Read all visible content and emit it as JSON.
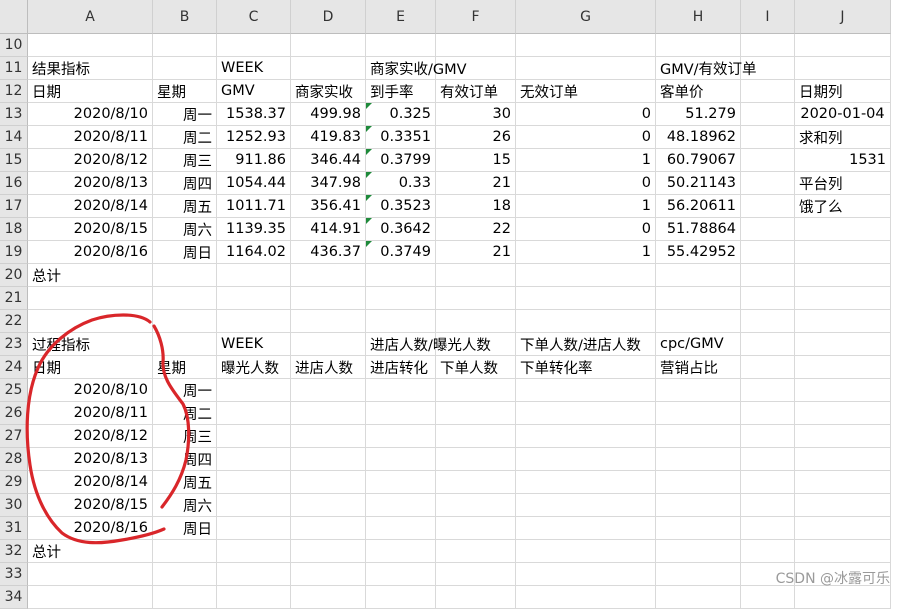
{
  "columns": [
    "A",
    "B",
    "C",
    "D",
    "E",
    "F",
    "G",
    "H",
    "I",
    "J"
  ],
  "rows": [
    10,
    11,
    12,
    13,
    14,
    15,
    16,
    17,
    18,
    19,
    20,
    21,
    22,
    23,
    24,
    25,
    26,
    27,
    28,
    29,
    30,
    31,
    32,
    33,
    34
  ],
  "cells": [
    {
      "r": 11,
      "c": "A",
      "v": "结果指标"
    },
    {
      "r": 11,
      "c": "C",
      "v": "WEEK"
    },
    {
      "r": 11,
      "c": "E",
      "v": "商家实收/GMV"
    },
    {
      "r": 11,
      "c": "H",
      "v": "GMV/有效订单"
    },
    {
      "r": 12,
      "c": "A",
      "v": "日期"
    },
    {
      "r": 12,
      "c": "B",
      "v": "星期"
    },
    {
      "r": 12,
      "c": "C",
      "v": "GMV"
    },
    {
      "r": 12,
      "c": "D",
      "v": "商家实收"
    },
    {
      "r": 12,
      "c": "E",
      "v": "到手率"
    },
    {
      "r": 12,
      "c": "F",
      "v": "有效订单"
    },
    {
      "r": 12,
      "c": "G",
      "v": "无效订单"
    },
    {
      "r": 12,
      "c": "H",
      "v": "客单价"
    },
    {
      "r": 12,
      "c": "J",
      "v": "日期列"
    },
    {
      "r": 13,
      "c": "A",
      "v": "2020/8/10",
      "a": "num"
    },
    {
      "r": 13,
      "c": "B",
      "v": "周一",
      "a": "num"
    },
    {
      "r": 13,
      "c": "C",
      "v": "1538.37",
      "a": "num"
    },
    {
      "r": 13,
      "c": "D",
      "v": "499.98",
      "a": "num"
    },
    {
      "r": 13,
      "c": "E",
      "v": "0.325",
      "a": "num",
      "tri": true
    },
    {
      "r": 13,
      "c": "F",
      "v": "30",
      "a": "num"
    },
    {
      "r": 13,
      "c": "G",
      "v": "0",
      "a": "num"
    },
    {
      "r": 13,
      "c": "H",
      "v": "51.279",
      "a": "num"
    },
    {
      "r": 13,
      "c": "J",
      "v": "2020-01-04",
      "a": "ctr"
    },
    {
      "r": 14,
      "c": "A",
      "v": "2020/8/11",
      "a": "num"
    },
    {
      "r": 14,
      "c": "B",
      "v": "周二",
      "a": "num"
    },
    {
      "r": 14,
      "c": "C",
      "v": "1252.93",
      "a": "num"
    },
    {
      "r": 14,
      "c": "D",
      "v": "419.83",
      "a": "num"
    },
    {
      "r": 14,
      "c": "E",
      "v": "0.3351",
      "a": "num",
      "tri": true
    },
    {
      "r": 14,
      "c": "F",
      "v": "26",
      "a": "num"
    },
    {
      "r": 14,
      "c": "G",
      "v": "0",
      "a": "num"
    },
    {
      "r": 14,
      "c": "H",
      "v": "48.18962",
      "a": "num"
    },
    {
      "r": 14,
      "c": "J",
      "v": "求和列"
    },
    {
      "r": 15,
      "c": "A",
      "v": "2020/8/12",
      "a": "num"
    },
    {
      "r": 15,
      "c": "B",
      "v": "周三",
      "a": "num"
    },
    {
      "r": 15,
      "c": "C",
      "v": "911.86",
      "a": "num"
    },
    {
      "r": 15,
      "c": "D",
      "v": "346.44",
      "a": "num"
    },
    {
      "r": 15,
      "c": "E",
      "v": "0.3799",
      "a": "num",
      "tri": true
    },
    {
      "r": 15,
      "c": "F",
      "v": "15",
      "a": "num"
    },
    {
      "r": 15,
      "c": "G",
      "v": "1",
      "a": "num"
    },
    {
      "r": 15,
      "c": "H",
      "v": "60.79067",
      "a": "num"
    },
    {
      "r": 15,
      "c": "J",
      "v": "1531",
      "a": "num"
    },
    {
      "r": 16,
      "c": "A",
      "v": "2020/8/13",
      "a": "num"
    },
    {
      "r": 16,
      "c": "B",
      "v": "周四",
      "a": "num"
    },
    {
      "r": 16,
      "c": "C",
      "v": "1054.44",
      "a": "num"
    },
    {
      "r": 16,
      "c": "D",
      "v": "347.98",
      "a": "num"
    },
    {
      "r": 16,
      "c": "E",
      "v": "0.33",
      "a": "num",
      "tri": true
    },
    {
      "r": 16,
      "c": "F",
      "v": "21",
      "a": "num"
    },
    {
      "r": 16,
      "c": "G",
      "v": "0",
      "a": "num"
    },
    {
      "r": 16,
      "c": "H",
      "v": "50.21143",
      "a": "num"
    },
    {
      "r": 16,
      "c": "J",
      "v": "平台列"
    },
    {
      "r": 17,
      "c": "A",
      "v": "2020/8/14",
      "a": "num"
    },
    {
      "r": 17,
      "c": "B",
      "v": "周五",
      "a": "num"
    },
    {
      "r": 17,
      "c": "C",
      "v": "1011.71",
      "a": "num"
    },
    {
      "r": 17,
      "c": "D",
      "v": "356.41",
      "a": "num"
    },
    {
      "r": 17,
      "c": "E",
      "v": "0.3523",
      "a": "num",
      "tri": true
    },
    {
      "r": 17,
      "c": "F",
      "v": "18",
      "a": "num"
    },
    {
      "r": 17,
      "c": "G",
      "v": "1",
      "a": "num"
    },
    {
      "r": 17,
      "c": "H",
      "v": "56.20611",
      "a": "num"
    },
    {
      "r": 17,
      "c": "J",
      "v": "饿了么"
    },
    {
      "r": 18,
      "c": "A",
      "v": "2020/8/15",
      "a": "num"
    },
    {
      "r": 18,
      "c": "B",
      "v": "周六",
      "a": "num"
    },
    {
      "r": 18,
      "c": "C",
      "v": "1139.35",
      "a": "num"
    },
    {
      "r": 18,
      "c": "D",
      "v": "414.91",
      "a": "num"
    },
    {
      "r": 18,
      "c": "E",
      "v": "0.3642",
      "a": "num",
      "tri": true
    },
    {
      "r": 18,
      "c": "F",
      "v": "22",
      "a": "num"
    },
    {
      "r": 18,
      "c": "G",
      "v": "0",
      "a": "num"
    },
    {
      "r": 18,
      "c": "H",
      "v": "51.78864",
      "a": "num"
    },
    {
      "r": 19,
      "c": "A",
      "v": "2020/8/16",
      "a": "num"
    },
    {
      "r": 19,
      "c": "B",
      "v": "周日",
      "a": "num"
    },
    {
      "r": 19,
      "c": "C",
      "v": "1164.02",
      "a": "num"
    },
    {
      "r": 19,
      "c": "D",
      "v": "436.37",
      "a": "num"
    },
    {
      "r": 19,
      "c": "E",
      "v": "0.3749",
      "a": "num",
      "tri": true
    },
    {
      "r": 19,
      "c": "F",
      "v": "21",
      "a": "num"
    },
    {
      "r": 19,
      "c": "G",
      "v": "1",
      "a": "num"
    },
    {
      "r": 19,
      "c": "H",
      "v": "55.42952",
      "a": "num"
    },
    {
      "r": 20,
      "c": "A",
      "v": "总计"
    },
    {
      "r": 23,
      "c": "A",
      "v": "过程指标"
    },
    {
      "r": 23,
      "c": "C",
      "v": "WEEK"
    },
    {
      "r": 23,
      "c": "E",
      "v": "进店人数/曝光人数"
    },
    {
      "r": 23,
      "c": "G",
      "v": "下单人数/进店人数"
    },
    {
      "r": 23,
      "c": "H",
      "v": "cpc/GMV"
    },
    {
      "r": 24,
      "c": "A",
      "v": "日期"
    },
    {
      "r": 24,
      "c": "B",
      "v": "星期"
    },
    {
      "r": 24,
      "c": "C",
      "v": "曝光人数"
    },
    {
      "r": 24,
      "c": "D",
      "v": "进店人数"
    },
    {
      "r": 24,
      "c": "E",
      "v": "进店转化"
    },
    {
      "r": 24,
      "c": "F",
      "v": "下单人数"
    },
    {
      "r": 24,
      "c": "G",
      "v": "下单转化率"
    },
    {
      "r": 24,
      "c": "H",
      "v": "营销占比"
    },
    {
      "r": 25,
      "c": "A",
      "v": "2020/8/10",
      "a": "num"
    },
    {
      "r": 25,
      "c": "B",
      "v": "周一",
      "a": "num"
    },
    {
      "r": 26,
      "c": "A",
      "v": "2020/8/11",
      "a": "num"
    },
    {
      "r": 26,
      "c": "B",
      "v": "周二",
      "a": "num"
    },
    {
      "r": 27,
      "c": "A",
      "v": "2020/8/12",
      "a": "num"
    },
    {
      "r": 27,
      "c": "B",
      "v": "周三",
      "a": "num"
    },
    {
      "r": 28,
      "c": "A",
      "v": "2020/8/13",
      "a": "num"
    },
    {
      "r": 28,
      "c": "B",
      "v": "周四",
      "a": "num"
    },
    {
      "r": 29,
      "c": "A",
      "v": "2020/8/14",
      "a": "num"
    },
    {
      "r": 29,
      "c": "B",
      "v": "周五",
      "a": "num"
    },
    {
      "r": 30,
      "c": "A",
      "v": "2020/8/15",
      "a": "num"
    },
    {
      "r": 30,
      "c": "B",
      "v": "周六",
      "a": "num"
    },
    {
      "r": 31,
      "c": "A",
      "v": "2020/8/16",
      "a": "num"
    },
    {
      "r": 31,
      "c": "B",
      "v": "周日",
      "a": "num"
    },
    {
      "r": 32,
      "c": "A",
      "v": "总计"
    }
  ],
  "annotation_color": "#d9262a",
  "indicator_color": "#1e8a3a",
  "watermark": "CSDN @冰露可乐"
}
